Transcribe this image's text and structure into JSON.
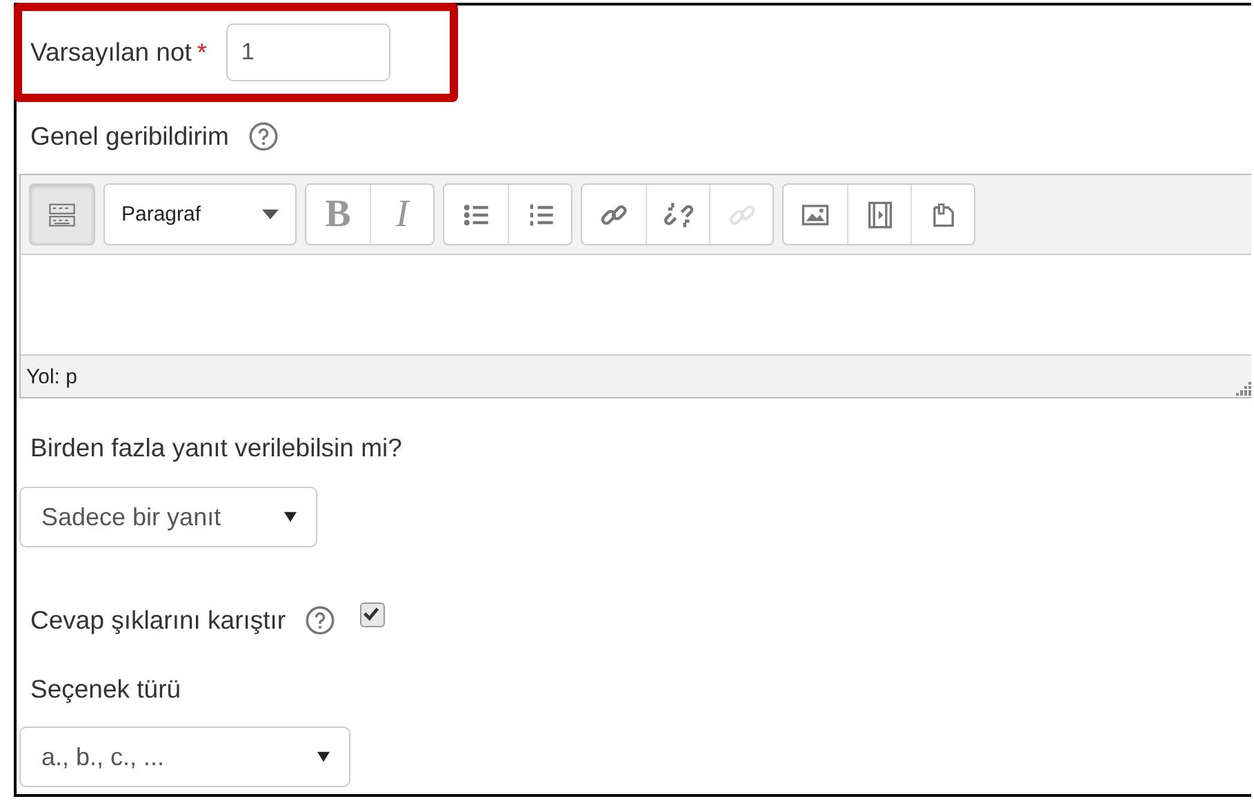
{
  "default_grade": {
    "label": "Varsayılan not",
    "required_mark": "*",
    "value": "1",
    "highlighted": true
  },
  "general_feedback": {
    "label": "Genel geribildirim",
    "toolbar": [
      {
        "kind": "toggle",
        "disabled": false
      },
      {
        "kind": "format",
        "label": "Paragraf",
        "disabled": false
      },
      {
        "kind": "bold",
        "label": "B",
        "disabled": false
      },
      {
        "kind": "italic",
        "label": "I",
        "disabled": false
      },
      {
        "kind": "bullets",
        "disabled": false
      },
      {
        "kind": "numbers",
        "disabled": false
      },
      {
        "kind": "link",
        "disabled": false
      },
      {
        "kind": "unlink",
        "disabled": false
      },
      {
        "kind": "anchor",
        "disabled": true
      },
      {
        "kind": "image",
        "disabled": false
      },
      {
        "kind": "media",
        "disabled": false
      },
      {
        "kind": "file",
        "disabled": false
      }
    ],
    "path": "Yol: p"
  },
  "single_answer": {
    "label": "Birden fazla yanıt verilebilsin mi?",
    "value": "Sadece bir yanıt"
  },
  "shuffle": {
    "label": "Cevap şıklarını karıştır",
    "checked": true
  },
  "numbering": {
    "label": "Seçenek türü",
    "value": "a., b., c., ..."
  }
}
